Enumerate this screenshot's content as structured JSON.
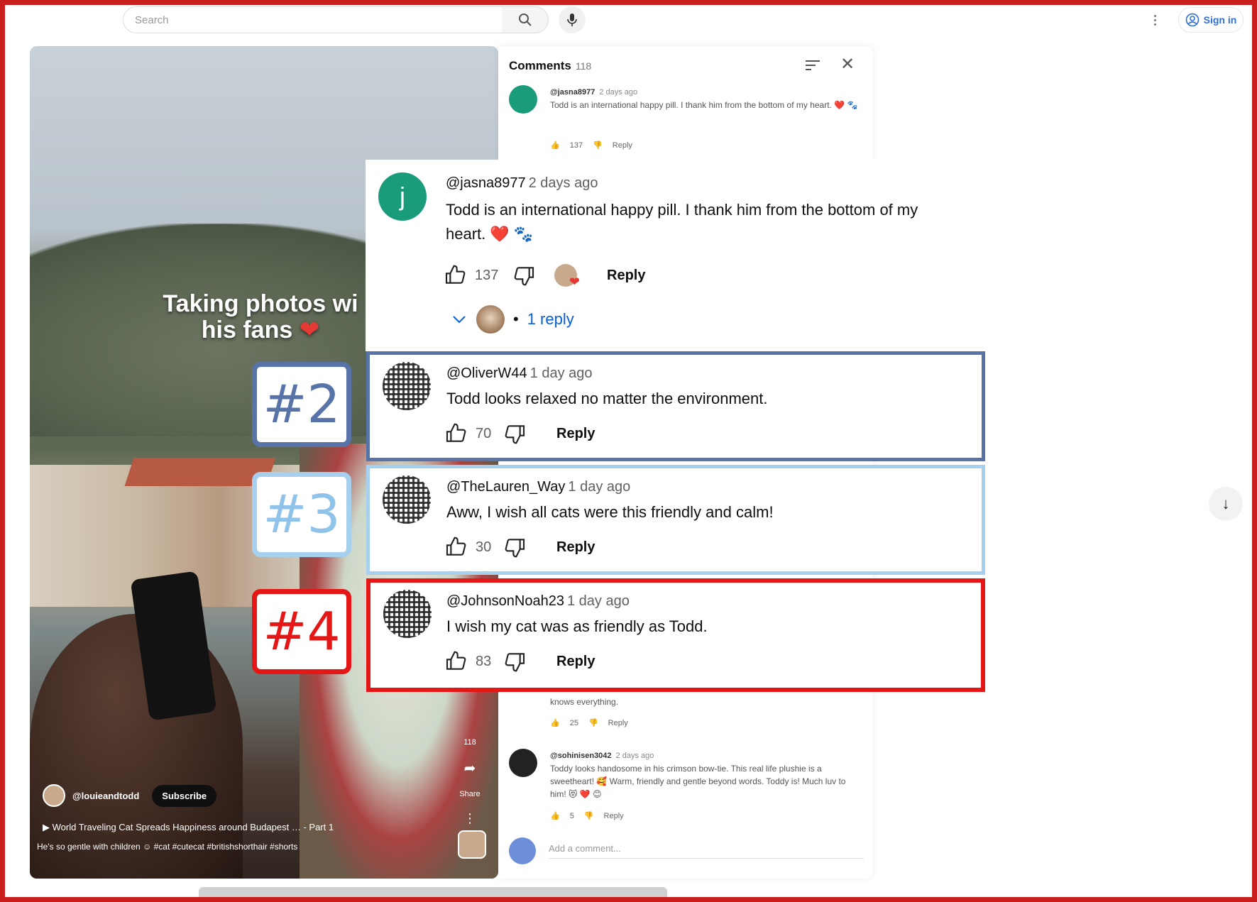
{
  "topbar": {
    "search_placeholder": "Search",
    "signin_label": "Sign in"
  },
  "video": {
    "caption_line1": "Taking photos wi",
    "caption_line2": "his fans",
    "channel": "@louieandtodd",
    "subscribe": "Subscribe",
    "title": "World Traveling Cat Spreads Happiness around Budapest … - Part 1",
    "description": "He's so gentle with children ☺ #cat #cutecat #britishshorthair #shorts",
    "share_label": "Share",
    "likes_label": "118"
  },
  "panel": {
    "title": "Comments",
    "count": "118",
    "comments": [
      {
        "user": "@jasna8977",
        "time": "2 days ago",
        "text": "Todd is an international happy pill. I thank him from the bottom of my heart. ❤️ 🐾",
        "likes": "137",
        "reply": "Reply"
      },
      {
        "user": "",
        "time": "",
        "text": "knows everything.",
        "likes": "25",
        "reply": "Reply"
      },
      {
        "user": "@sohinisen3042",
        "time": "2 days ago",
        "text": "Toddy looks handosome in his crimson bow-tie. This real life plushie is a sweetheart! 🥰 Warm, friendly and gentle beyond words. Toddy is! Much luv to him! 😻 ❤️ 😊",
        "likes": "5",
        "reply": "Reply"
      }
    ],
    "add_comment": "Add a comment..."
  },
  "zoom": {
    "top_comment": {
      "avatar_letter": "j",
      "user": "@jasna8977",
      "time": "2 days ago",
      "text_line1": "Todd is an international happy pill. I thank him from the bottom of my",
      "text_line2": "heart. ❤️ 🐾",
      "likes": "137",
      "reply": "Reply",
      "replies": "1 reply"
    },
    "comments": [
      {
        "tag": "#2",
        "user": "@OliverW44",
        "time": "1 day ago",
        "text": "Todd looks relaxed no matter the environment.",
        "likes": "70",
        "reply": "Reply"
      },
      {
        "tag": "#3",
        "user": "@TheLauren_Way",
        "time": "1 day ago",
        "text": "Aww, I wish all cats were this friendly and calm!",
        "likes": "30",
        "reply": "Reply"
      },
      {
        "tag": "#4",
        "user": "@JohnsonNoah23",
        "time": "1 day ago",
        "text": "I wish my cat was as friendly as Todd.",
        "likes": "83",
        "reply": "Reply"
      }
    ]
  },
  "colors": {
    "tag2": "#5873a8",
    "tag3": "#a7d0ee",
    "tag4": "#e41616",
    "frame": "#c81e1e",
    "avatar_j": "#1a9c7a"
  }
}
